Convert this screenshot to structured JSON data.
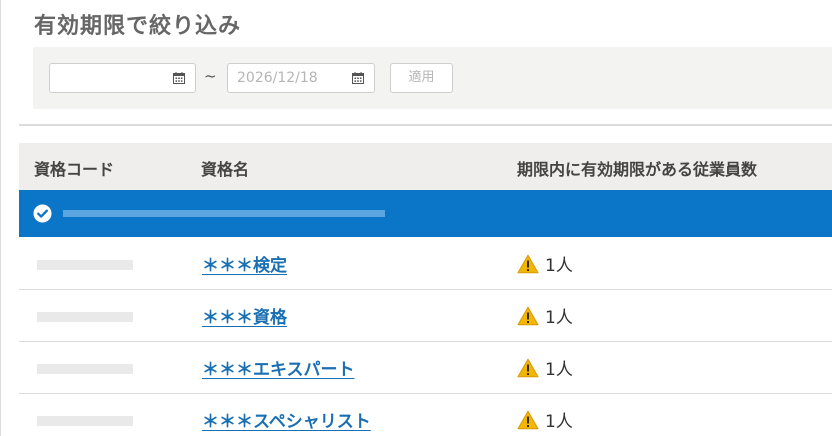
{
  "filter": {
    "title": "有効期限で絞り込み",
    "date_from": {
      "value": "",
      "placeholder": ""
    },
    "separator": "~",
    "date_to": {
      "value": "",
      "placeholder": "2026/12/18"
    },
    "apply_label": "適用"
  },
  "table": {
    "headers": {
      "code": "資格コード",
      "name": "資格名",
      "count": "期限内に有効期限がある従業員数"
    },
    "rows": [
      {
        "name": "＊＊＊検定",
        "count": "1人"
      },
      {
        "name": "＊＊＊資格",
        "count": "1人"
      },
      {
        "name": "＊＊＊エキスパート",
        "count": "1人"
      },
      {
        "name": "＊＊＊スペシャリスト",
        "count": "1人"
      }
    ]
  },
  "icons": {
    "calendar": "calendar-icon",
    "selected": "check-circle-icon",
    "warning": "warning-icon"
  },
  "colors": {
    "selected_row": "#0b76c8",
    "link": "#1a6fb3",
    "warning": "#f2b705",
    "header_bg": "#efeeec"
  }
}
